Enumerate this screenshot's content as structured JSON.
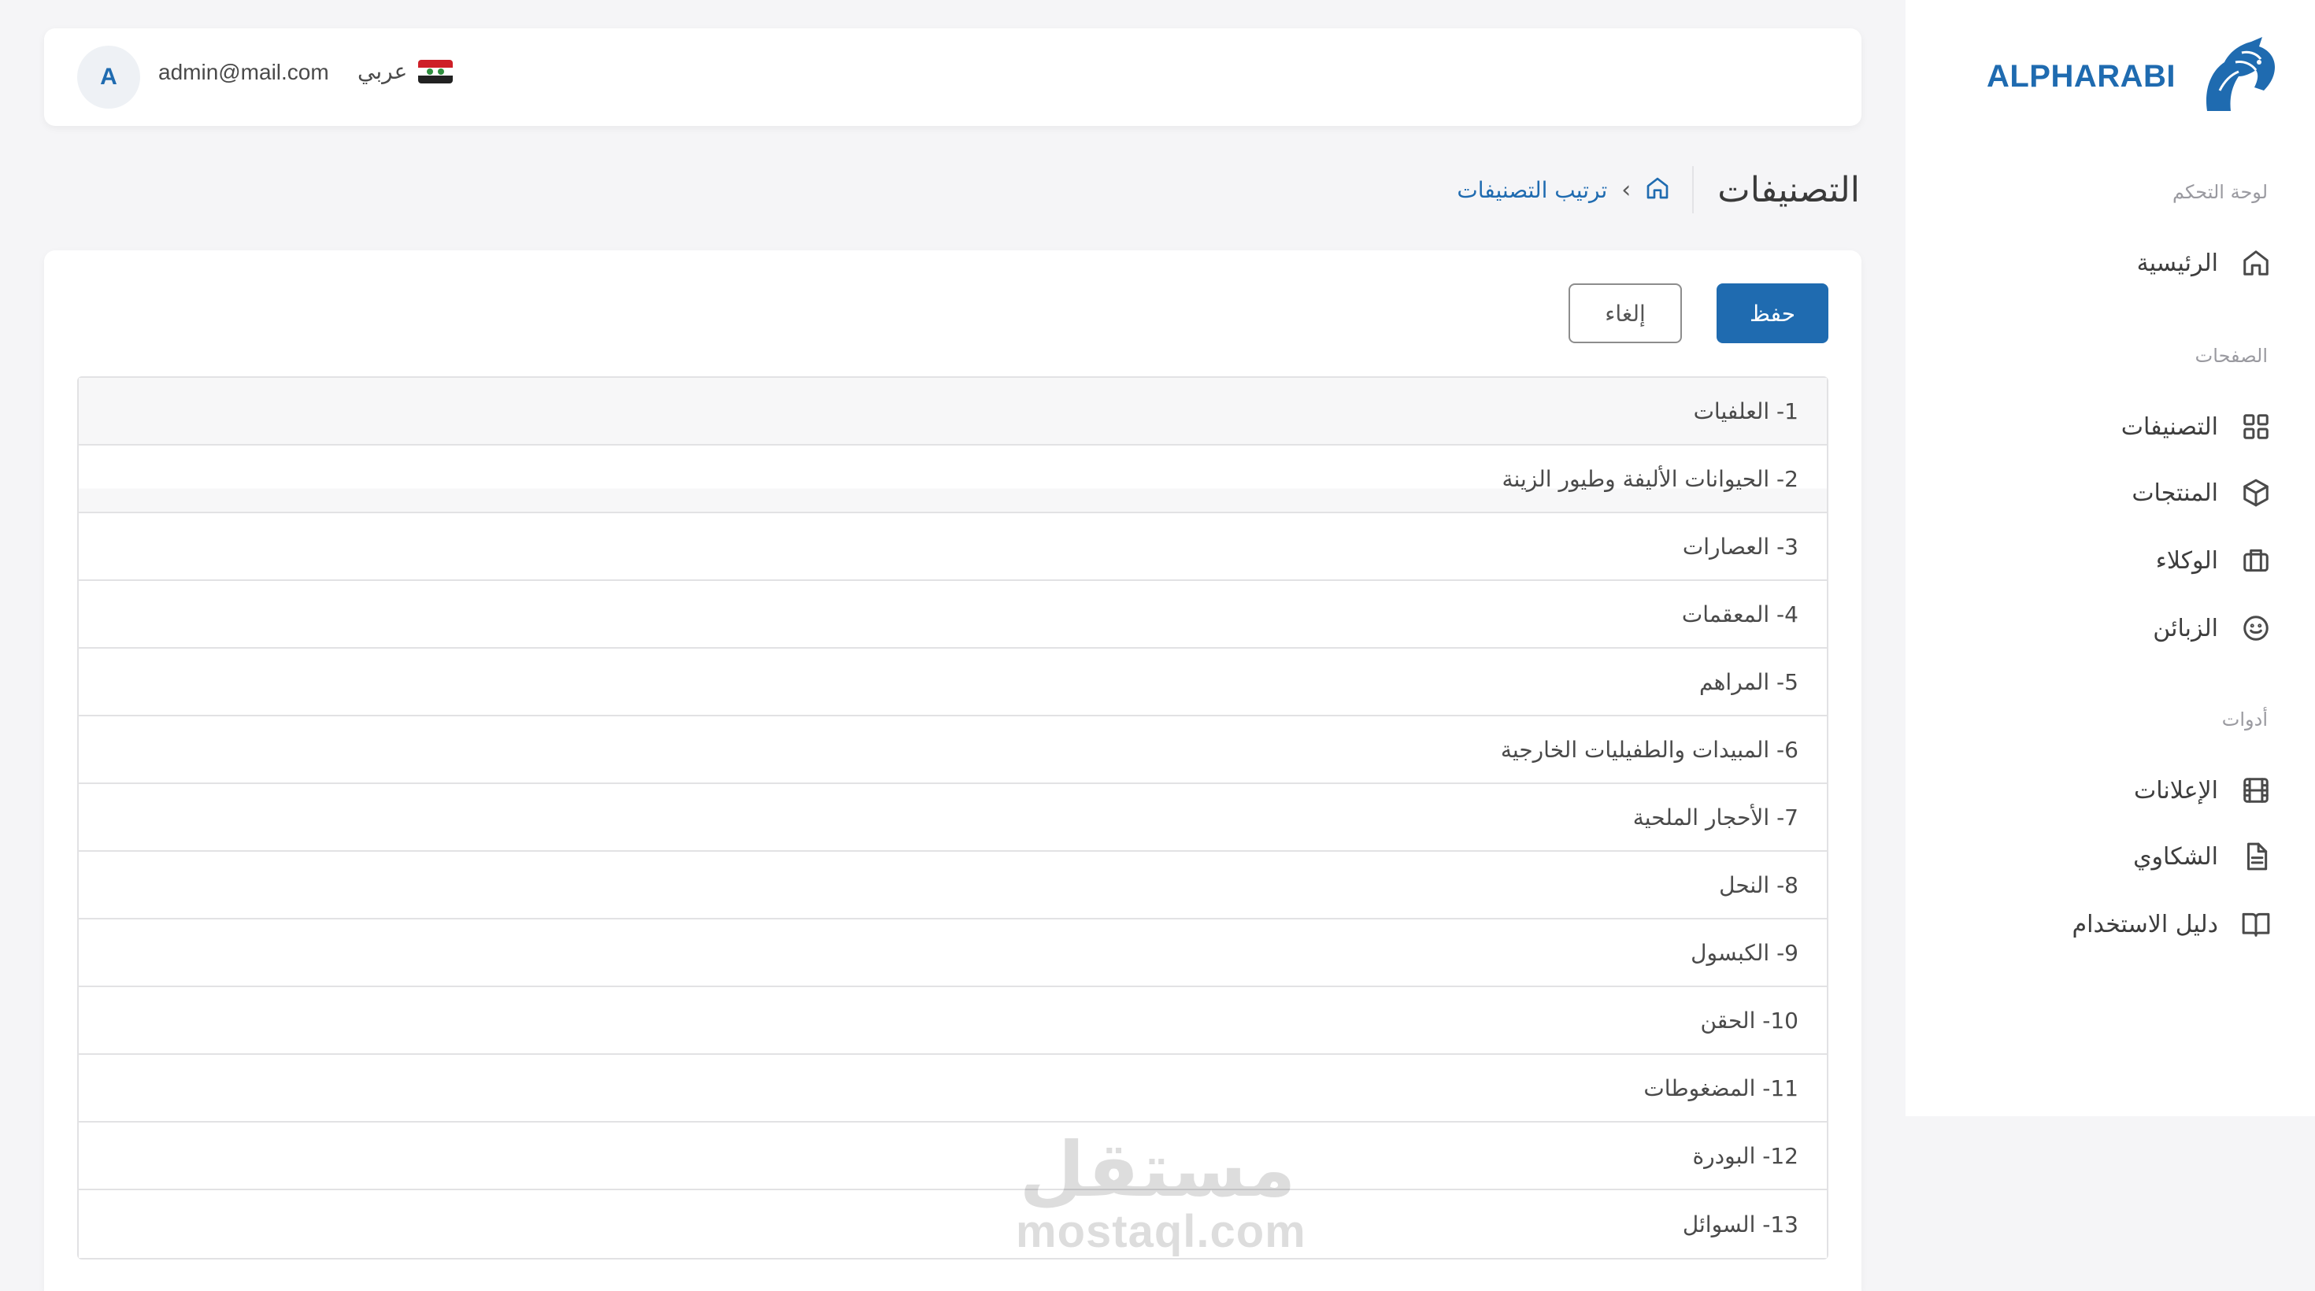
{
  "brand": {
    "name": "ALPHARABI",
    "color": "#1f6bb0"
  },
  "sidebar": {
    "sections": [
      {
        "title": "لوحة التحكم",
        "items": [
          {
            "label": "الرئيسية",
            "icon": "home-icon"
          }
        ]
      },
      {
        "title": "الصفحات",
        "items": [
          {
            "label": "التصنيفات",
            "icon": "grid-icon"
          },
          {
            "label": "المنتجات",
            "icon": "box-icon"
          },
          {
            "label": "الوكلاء",
            "icon": "briefcase-icon"
          },
          {
            "label": "الزبائن",
            "icon": "smile-icon"
          }
        ]
      },
      {
        "title": "أدوات",
        "items": [
          {
            "label": "الإعلانات",
            "icon": "film-icon"
          },
          {
            "label": "الشكاوي",
            "icon": "document-icon"
          },
          {
            "label": "دليل الاستخدام",
            "icon": "book-icon"
          }
        ]
      }
    ]
  },
  "topbar": {
    "avatar_initial": "A",
    "email": "admin@mail.com",
    "language": "عربي",
    "flag_icon": "syria-flag-icon"
  },
  "page": {
    "title": "التصنيفات",
    "breadcrumb": {
      "home_icon": "home-icon",
      "separator": "›",
      "current": "ترتيب التصنيفات"
    }
  },
  "actions": {
    "save": "حفظ",
    "cancel": "إلغاء"
  },
  "categories": [
    "1- العلفيات",
    "2- الحيوانات الأليفة وطيور الزينة",
    "3- العصارات",
    "4- المعقمات",
    "5- المراهم",
    "6- المبيدات والطفيليات الخارجية",
    "7- الأحجار الملحية",
    "8- النحل",
    "9- الكبسول",
    "10- الحقن",
    "11- المضغوطات",
    "12- البودرة",
    "13- السوائل"
  ],
  "watermark": {
    "arabic": "مستقل",
    "latin": "mostaql.com"
  },
  "colors": {
    "accent": "#1f6bb0",
    "background": "#f5f5f7",
    "border": "#e2e2e4"
  }
}
